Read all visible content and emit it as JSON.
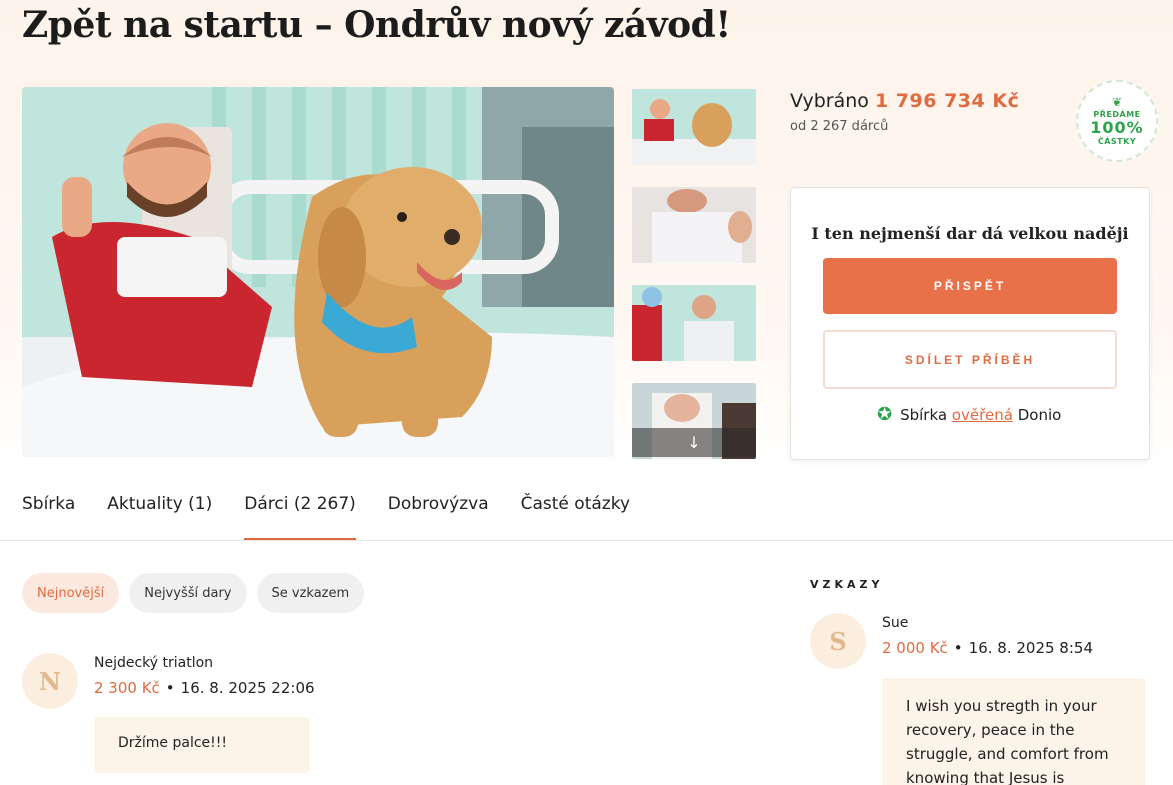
{
  "page": {
    "title": "Zpět na startu – Ondrův nový závod!"
  },
  "gallery": {
    "scroll_down_icon": "arrow-down-icon",
    "thumbnail_count": 4
  },
  "stats": {
    "raised_label": "Vybráno",
    "raised_amount": "1 796 734 Kč",
    "donors_text": "od 2 267 dárců"
  },
  "badge": {
    "icon": "hands-icon",
    "top": "PŘEDÁME",
    "percent": "100%",
    "bottom": "ČÁSTKY"
  },
  "donate_card": {
    "heading": "I ten nejmenší dar dá velkou naději",
    "donate_label": "PŘISPĚT",
    "share_label": "SDÍLET PŘÍBĚH",
    "verified_prefix": "Sbírka",
    "verified_link": "ověřená",
    "verified_suffix": "Donio"
  },
  "tabs": [
    {
      "label": "Sbírka"
    },
    {
      "label": "Aktuality (1)"
    },
    {
      "label": "Dárci (2 267)",
      "active": true
    },
    {
      "label": "Dobrovýzva"
    },
    {
      "label": "Časté otázky"
    }
  ],
  "filters": [
    {
      "label": "Nejnovější",
      "active": true
    },
    {
      "label": "Nejvyšší dary"
    },
    {
      "label": "Se vzkazem"
    }
  ],
  "donations": [
    {
      "initial": "N",
      "name": "Nejdecký triatlon",
      "amount": "2 300 Kč",
      "date": "16. 8. 2025 22:06",
      "message": "Držíme palce!!!"
    }
  ],
  "messages": {
    "heading": "VZKAZY",
    "items": [
      {
        "initial": "S",
        "name": "Sue",
        "amount": "2 000 Kč",
        "date": "16. 8. 2025 8:54",
        "lines": [
          "I wish you stregth in your",
          "recovery, peace in the",
          "struggle, and comfort from",
          "knowing that Jesus is"
        ]
      }
    ]
  },
  "colors": {
    "accent": "#e8714a",
    "verified_green": "#2fa24a",
    "hero_bg": "#fdf3ea"
  }
}
